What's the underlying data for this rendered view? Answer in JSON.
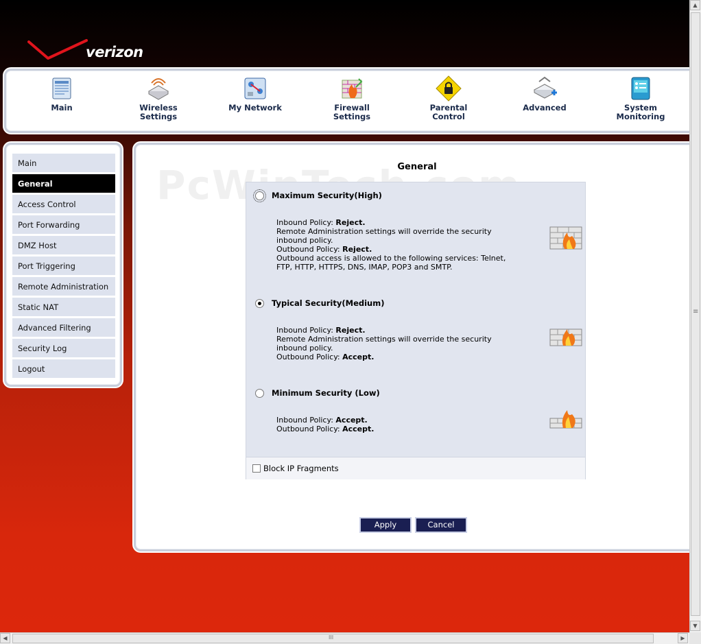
{
  "brand": {
    "logo_text": "verizon"
  },
  "nav": {
    "items": [
      {
        "label": "Main",
        "icon": "main-icon"
      },
      {
        "label": "Wireless\nSettings",
        "icon": "wireless-icon"
      },
      {
        "label": "My Network",
        "icon": "network-icon"
      },
      {
        "label": "Firewall\nSettings",
        "icon": "firewall-icon"
      },
      {
        "label": "Parental\nControl",
        "icon": "parental-lock-icon"
      },
      {
        "label": "Advanced",
        "icon": "advanced-icon"
      },
      {
        "label": "System\nMonitoring",
        "icon": "monitoring-icon"
      }
    ]
  },
  "sidebar": {
    "items": [
      {
        "label": "Main"
      },
      {
        "label": "General",
        "active": true
      },
      {
        "label": "Access Control"
      },
      {
        "label": "Port Forwarding"
      },
      {
        "label": "DMZ Host"
      },
      {
        "label": "Port Triggering"
      },
      {
        "label": "Remote Administration"
      },
      {
        "label": "Static NAT"
      },
      {
        "label": "Advanced Filtering"
      },
      {
        "label": "Security Log"
      },
      {
        "label": "Logout"
      }
    ]
  },
  "content": {
    "title": "General",
    "watermark": "PcWinTech.com",
    "levels": [
      {
        "label": "Maximum Security(High)",
        "selected": false,
        "lines": [
          {
            "text": "Inbound Policy: ",
            "bold": "Reject."
          },
          {
            "text": "Remote Administration settings will override the security"
          },
          {
            "text": "inbound policy."
          },
          {
            "text": "Outbound Policy: ",
            "bold": "Reject."
          },
          {
            "text": "Outbound access is allowed to the following services: Telnet,"
          },
          {
            "text": "FTP, HTTP, HTTPS, DNS, IMAP, POP3 and SMTP."
          }
        ]
      },
      {
        "label": "Typical Security(Medium)",
        "selected": true,
        "lines": [
          {
            "text": "Inbound Policy: ",
            "bold": "Reject."
          },
          {
            "text": "Remote Administration settings will override the security"
          },
          {
            "text": "inbound policy."
          },
          {
            "text": "Outbound Policy: ",
            "bold": "Accept."
          }
        ]
      },
      {
        "label": "Minimum Security (Low)",
        "selected": false,
        "lines": [
          {
            "text": "Inbound Policy: ",
            "bold": "Accept."
          },
          {
            "text": "Outbound Policy: ",
            "bold": "Accept."
          }
        ]
      }
    ],
    "block_ip_fragments": {
      "label": "Block IP Fragments",
      "checked": false
    },
    "apply_label": "Apply",
    "cancel_label": "Cancel"
  },
  "colors": {
    "accent_red": "#d8270c",
    "sidebar_active": "#000000",
    "button": "#1a1f52"
  }
}
